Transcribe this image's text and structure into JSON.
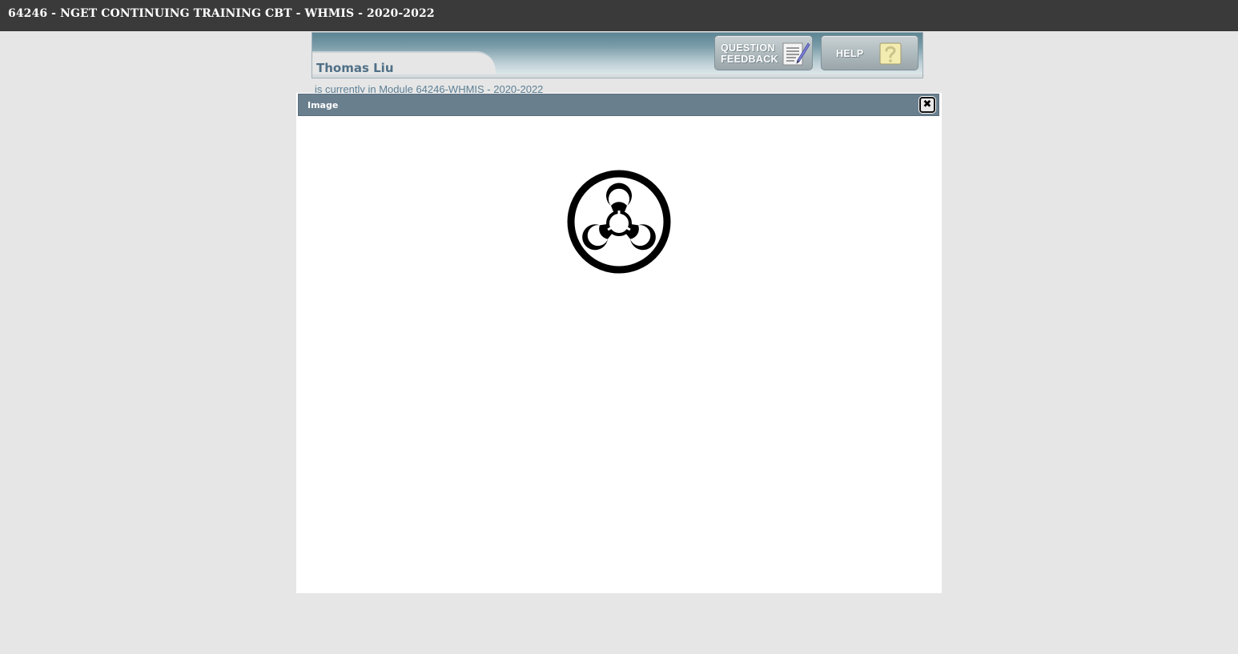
{
  "window": {
    "title": "64246 - NGET CONTINUING TRAINING CBT - WHMIS - 2020-2022"
  },
  "header": {
    "user_name": "Thomas Liu",
    "module_line": "is currently in Module 64246-WHMIS - 2020-2022",
    "question_feedback_label_line1": "QUESTION",
    "question_feedback_label_line2": "FEEDBACK",
    "question_feedback_icon": "notepad-pencil-icon",
    "help_label": "HELP",
    "help_icon": "question-mark-icon"
  },
  "modal": {
    "title": "Image",
    "close_label": "✖",
    "image_icon": "biohazard-symbol-icon"
  },
  "colors": {
    "titlebar_bg": "#3a3a3a",
    "modal_header_bg": "#6a7f8e",
    "page_bg": "#e6e6e6",
    "user_name": "#4f6f86"
  }
}
